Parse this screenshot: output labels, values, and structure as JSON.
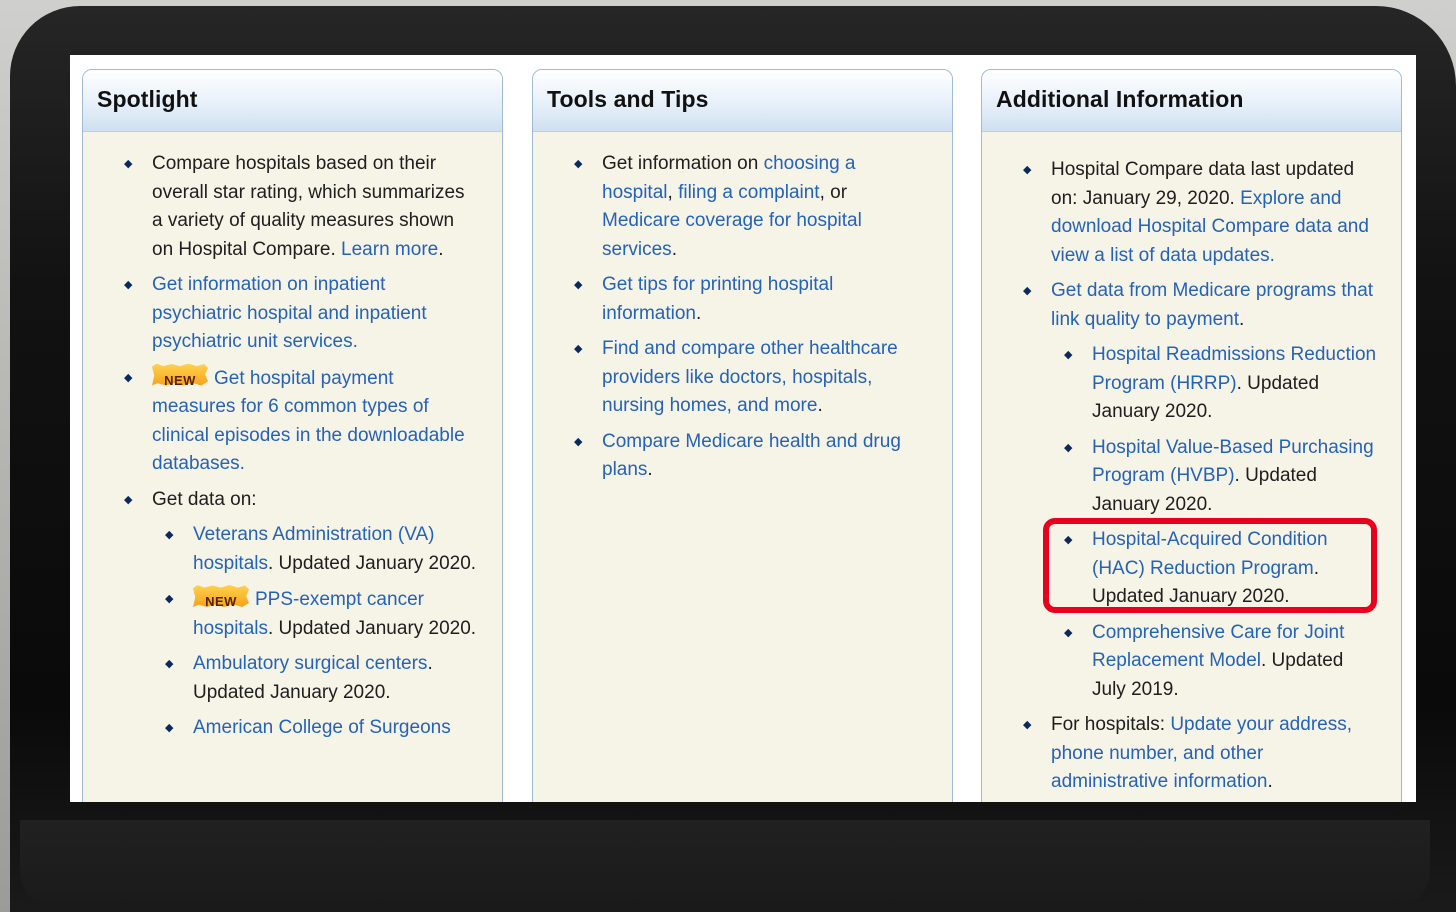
{
  "colors": {
    "link": "#2563b8",
    "highlight": "#e8001c",
    "panel_bg": "#f6f3e7"
  },
  "spotlight": {
    "title": "Spotlight",
    "item1": {
      "text": "Compare hospitals based on their overall star rating, which summarizes a variety of quality measures shown on Hospital Compare. ",
      "link": "Learn more",
      "tail": "."
    },
    "item2": {
      "link": "Get information on inpatient psychiatric hospital and inpatient psychiatric unit services."
    },
    "item3": {
      "badge": "NEW",
      "link": "Get hospital payment measures for 6 common types of clinical episodes in the downloadable databases."
    },
    "item4": {
      "text": "Get data on:",
      "sub1": {
        "link": "Veterans Administration (VA) hospitals",
        "text": ". Updated January 2020."
      },
      "sub2": {
        "badge": "NEW",
        "link": "PPS-exempt cancer hospitals",
        "text": ". Updated January 2020."
      },
      "sub3": {
        "link": "Ambulatory surgical centers",
        "text": ". Updated January 2020."
      },
      "sub4": {
        "link": "American College of Surgeons"
      }
    }
  },
  "tools": {
    "title": "Tools and Tips",
    "item1": {
      "text1": "Get information on ",
      "link1": "choosing a hospital",
      "text2": ", ",
      "link2": "filing a complaint",
      "text3": ", or ",
      "link3": "Medicare coverage for hospital services",
      "text4": "."
    },
    "item2": {
      "link": "Get tips for printing hospital information",
      "tail": "."
    },
    "item3": {
      "link": "Find and compare other healthcare providers like doctors, hospitals, nursing homes, and more",
      "tail": "."
    },
    "item4": {
      "link": "Compare Medicare health and drug plans",
      "tail": "."
    }
  },
  "additional": {
    "title": "Additional Information",
    "item1": {
      "text": "Hospital Compare data last updated on: January 29, 2020. ",
      "link": "Explore and download Hospital Compare data and view a list of data updates."
    },
    "item2": {
      "link": "Get data from Medicare programs that link quality to payment",
      "tail": ".",
      "sub1": {
        "link": "Hospital Readmissions Reduction Program (HRRP)",
        "text": ". Updated January 2020."
      },
      "sub2": {
        "link": "Hospital Value-Based Purchasing Program (HVBP)",
        "text": ". Updated January 2020."
      },
      "sub3": {
        "link": "Hospital-Acquired Condition (HAC) Reduction Program",
        "text": ". Updated January 2020."
      },
      "sub4": {
        "link": "Comprehensive Care for Joint Replacement Model",
        "text": ". Updated July 2019."
      }
    },
    "item3": {
      "text": "For hospitals: ",
      "link": "Update your address, phone number, and other administrative information",
      "tail": "."
    }
  }
}
